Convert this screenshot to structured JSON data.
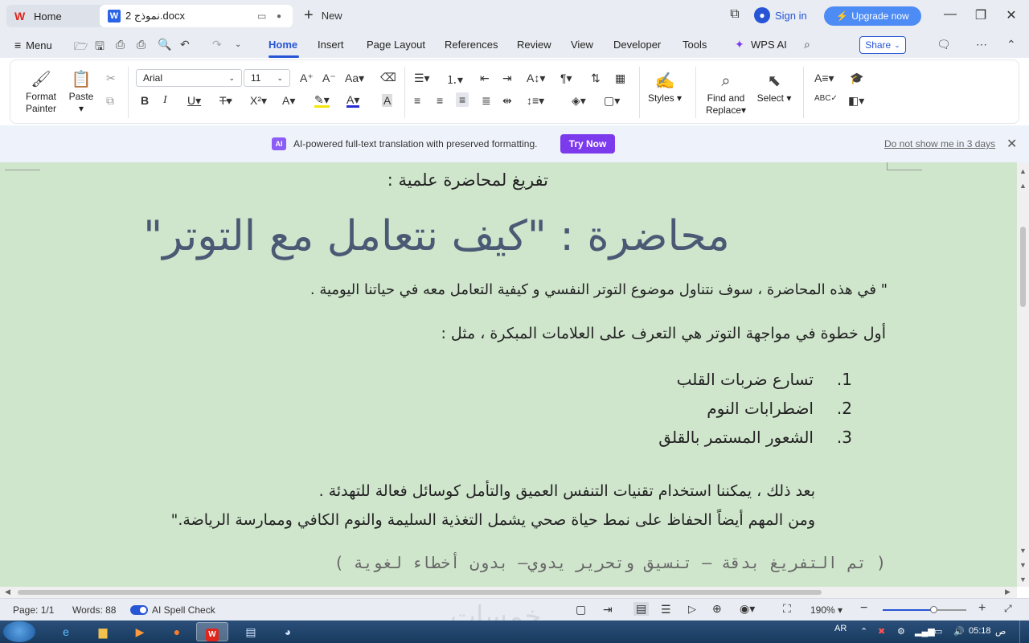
{
  "titlebar": {
    "home_tab": "Home",
    "doc_tab": "نموذج 2.docx",
    "new_tab": "New",
    "sign_in": "Sign in",
    "upgrade": "Upgrade now"
  },
  "menubar": {
    "menu": "Menu",
    "items": [
      "Home",
      "Insert",
      "Page Layout",
      "References",
      "Review",
      "View",
      "Developer",
      "Tools",
      "WPS AI"
    ],
    "share": "Share"
  },
  "ribbon": {
    "format_painter": "Format Painter",
    "format_painter_l1": "Format",
    "format_painter_l2": "Painter",
    "paste": "Paste",
    "font_name": "Arial",
    "font_size": "11",
    "styles": "Styles",
    "find_replace_l1": "Find and",
    "find_replace_l2": "Replace",
    "select": "Select"
  },
  "notification": {
    "badge": "AI",
    "text": "AI-powered full-text translation with preserved formatting.",
    "button": "Try Now",
    "dismiss": "Do not show me in 3 days"
  },
  "document": {
    "subtitle": "تفريغ لمحاضرة علمية :",
    "title": "محاضرة : \"كيف نتعامل مع التوتر\"",
    "intro": "\" في هذه المحاضرة ، سوف نتناول موضوع التوتر النفسي و كيفية التعامل معه في حياتنا اليومية .",
    "first_step": "أول خطوة في مواجهة التوتر هي التعرف على العلامات المبكرة ، مثل :",
    "list": [
      {
        "num": "1.",
        "text": "تسارع ضربات القلب"
      },
      {
        "num": "2.",
        "text": "اضطرابات النوم"
      },
      {
        "num": "3.",
        "text": "الشعور المستمر بالقلق"
      }
    ],
    "after": "بعد ذلك ، يمكننا استخدام تقنيات التنفس العميق والتأمل كوسائل فعالة للتهدئة .",
    "lifestyle": "ومن المهم أيضاً الحفاظ على نمط حياة صحي يشمل التغذية السليمة  والنوم الكافي وممارسة الرياضة.\"",
    "footer_note": "( تم التفريغ بدقة – تنسيق وتحرير يدوي– بدون أخطاء لغوية )"
  },
  "statusbar": {
    "page": "Page: 1/1",
    "words": "Words: 88",
    "spell": "AI Spell Check",
    "zoom": "190%",
    "watermark": "خمسات"
  },
  "taskbar": {
    "lang": "AR",
    "time": "05:18",
    "ampm": "ص"
  }
}
